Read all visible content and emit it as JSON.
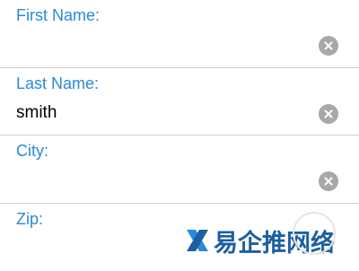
{
  "form": {
    "fields": [
      {
        "label": "First Name:",
        "value": "",
        "clear_icon": "clear-circle-x"
      },
      {
        "label": "Last Name:",
        "value": "smith",
        "clear_icon": "clear-circle-x"
      },
      {
        "label": "City:",
        "value": "",
        "clear_icon": "clear-circle-x"
      },
      {
        "label": "Zip:",
        "value": ""
      }
    ],
    "label_color": "#2a8ad9",
    "clear_icon_color": "#a8a8a8"
  },
  "watermark": {
    "text": "易企推网络",
    "brand_color": "#1d5fa0"
  }
}
